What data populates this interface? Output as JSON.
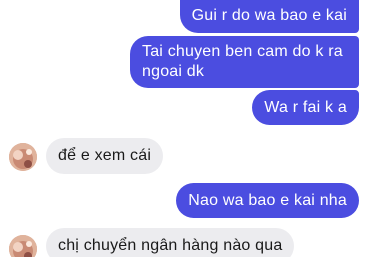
{
  "colors": {
    "outgoing_bubble": "#4b4de0",
    "incoming_bubble": "#ececef",
    "background": "#ffffff"
  },
  "messages": [
    {
      "direction": "outgoing",
      "text": "Gui r do wa bao e kai"
    },
    {
      "direction": "outgoing",
      "lines": [
        "Tai chuyen ben cam do k ra",
        "ngoai dk"
      ]
    },
    {
      "direction": "outgoing",
      "text": "Wa r fai k a"
    },
    {
      "direction": "incoming",
      "text": "để e xem cái",
      "avatar_icon": "contact-avatar-icon"
    },
    {
      "direction": "outgoing",
      "text": "Nao wa bao e kai nha"
    },
    {
      "direction": "incoming",
      "text": "chị chuyển ngân hàng nào qua",
      "avatar_icon": "contact-avatar-icon"
    }
  ]
}
